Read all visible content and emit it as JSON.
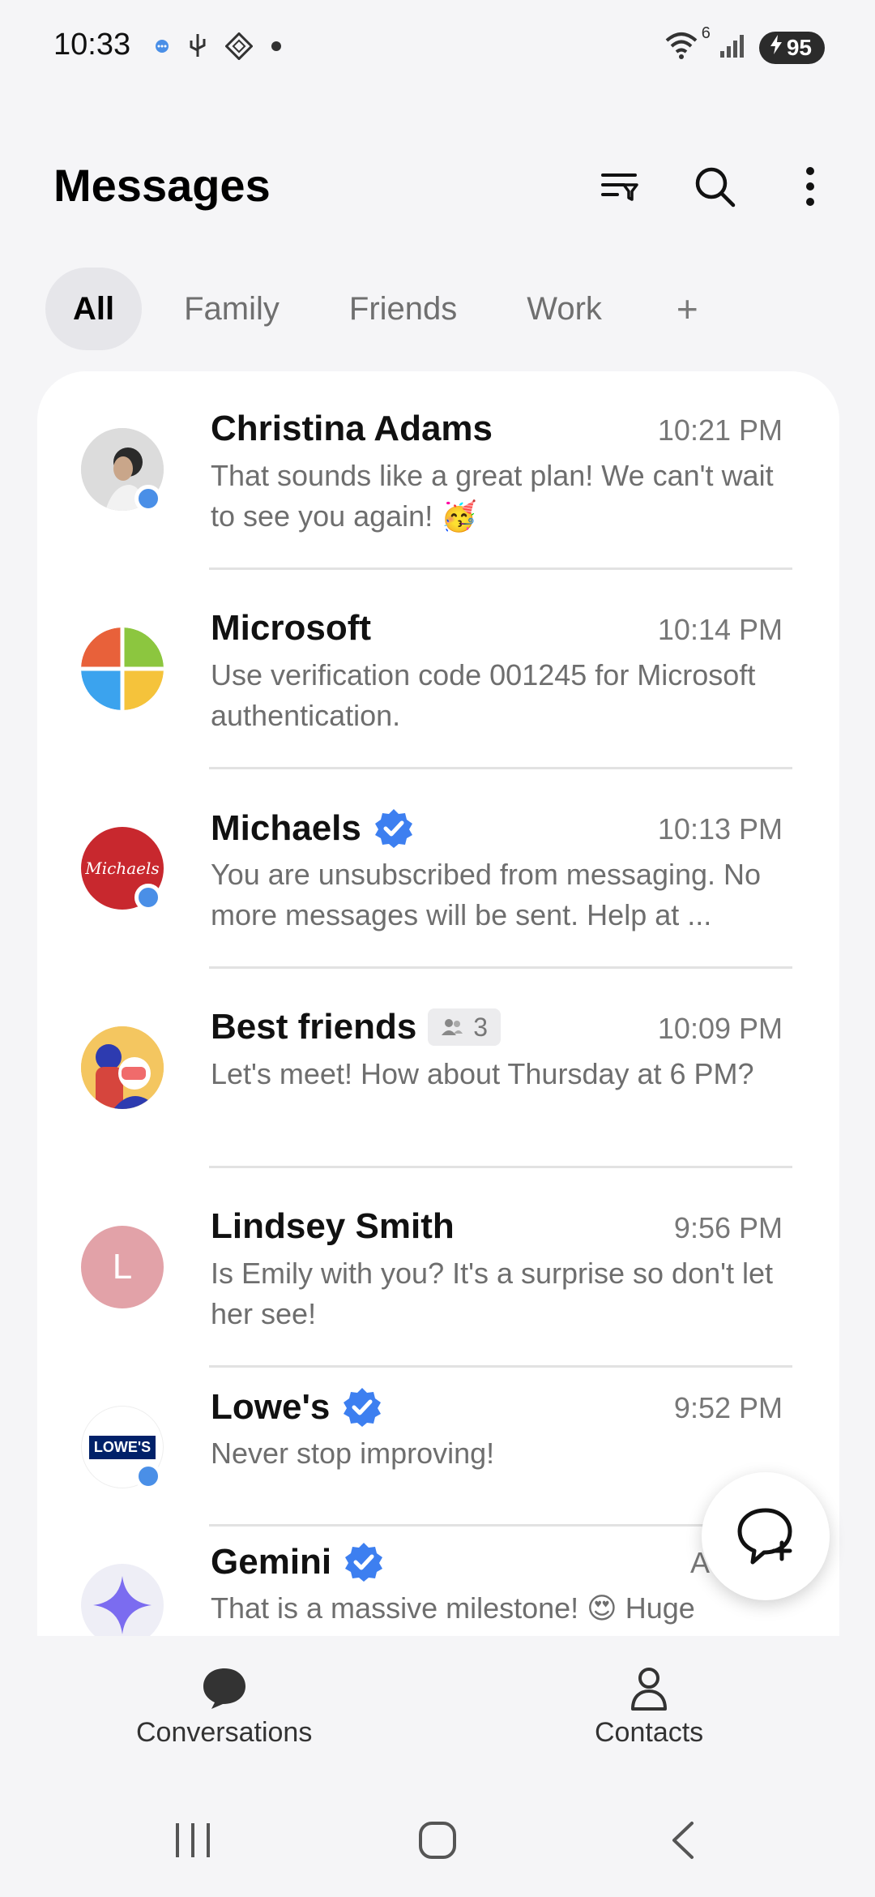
{
  "status_bar": {
    "time": "10:33",
    "battery": "95",
    "wifi_badge": "6"
  },
  "header": {
    "title": "Messages"
  },
  "tabs": [
    {
      "label": "All",
      "active": true
    },
    {
      "label": "Family",
      "active": false
    },
    {
      "label": "Friends",
      "active": false
    },
    {
      "label": "Work",
      "active": false
    }
  ],
  "tab_add": "+",
  "conversations": [
    {
      "name": "Christina Adams",
      "time": "10:21 PM",
      "preview": "That sounds like a great plan! We can't wait to see you again! 🥳",
      "unread": true,
      "verified": false
    },
    {
      "name": "Microsoft",
      "time": "10:14 PM",
      "preview": "Use verification code 001245 for Microsoft authentication.",
      "unread": false,
      "verified": false
    },
    {
      "name": "Michaels",
      "time": "10:13 PM",
      "preview": "You are unsubscribed from messaging. No more messages will be sent. Help at ...",
      "unread": true,
      "verified": true,
      "logo_text": "Michaels"
    },
    {
      "name": "Best friends",
      "time": "10:09 PM",
      "preview": "Let's meet! How about Thursday at 6 PM?",
      "unread": false,
      "verified": false,
      "members": "3"
    },
    {
      "name": "Lindsey Smith",
      "time": "9:56 PM",
      "preview": "Is Emily with you? It's a surprise so don't let her see!",
      "unread": false,
      "verified": false,
      "initial": "L"
    },
    {
      "name": "Lowe's",
      "time": "9:52 PM",
      "preview": "Never stop improving!",
      "unread": true,
      "verified": true,
      "logo_text": "LOWE'S"
    },
    {
      "name": "Gemini",
      "time": "Aug",
      "preview": "That is a massive milestone! 😍 Huge",
      "unread": false,
      "verified": true
    }
  ],
  "bottom_nav": {
    "conversations": "Conversations",
    "contacts": "Contacts"
  },
  "colors": {
    "accent_blue": "#4a8fe7",
    "verified_blue": "#3d7ff0"
  }
}
